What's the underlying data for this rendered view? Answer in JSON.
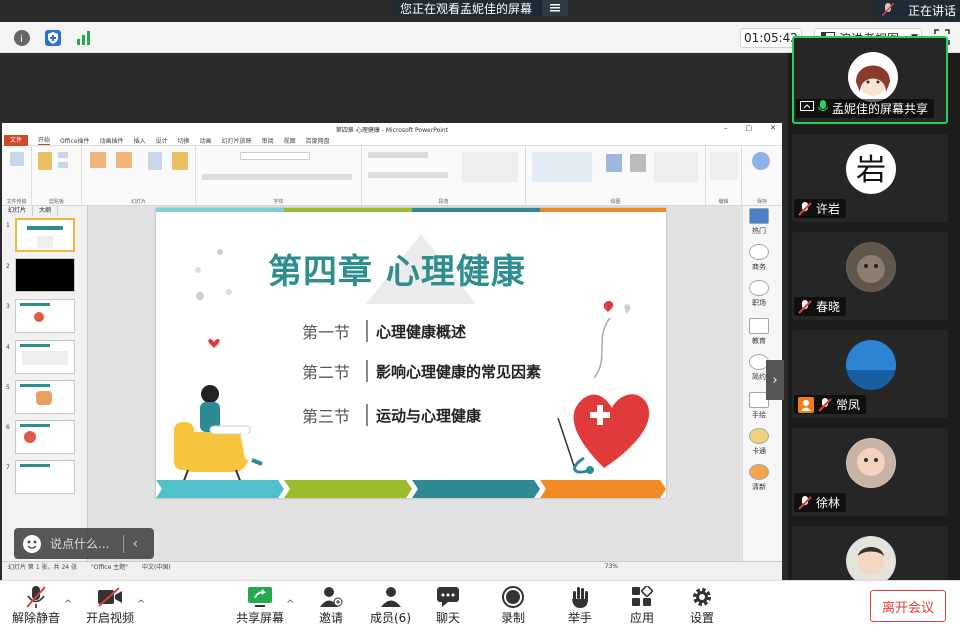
{
  "banner": {
    "viewing_text": "您正在观看孟妮佳的屏幕",
    "speaking_text": "正在讲话"
  },
  "toolbar": {
    "timer": "01:05:42",
    "view_label": "演讲者视图"
  },
  "ppt": {
    "window_title": "第四章 心理健康 - Microsoft PowerPoint",
    "tabs": [
      "文件",
      "开始",
      "Office插件",
      "动画插件",
      "插入",
      "设计",
      "切换",
      "动画",
      "幻灯片放映",
      "审阅",
      "视图",
      "百度网盘"
    ],
    "ribbon_groups": [
      "文件传输",
      "剪贴板",
      "幻灯片",
      "字体",
      "段落",
      "绘图",
      "编辑",
      "保存"
    ],
    "thumb_tabs": [
      "幻灯片",
      "大纲"
    ],
    "thumb_numbers": [
      "1",
      "2",
      "3",
      "4",
      "5",
      "6",
      "7"
    ],
    "status": {
      "slide_info": "幻灯片 第 1 张，共 24 张",
      "theme": "\"Office 主题\"",
      "language": "中文(中国)",
      "zoom": "73%"
    },
    "right_pane": [
      "热门",
      "商务",
      "职场",
      "教育",
      "简约",
      "手绘",
      "卡通",
      "清新"
    ]
  },
  "slide": {
    "title": "第四章  心理健康",
    "sections": [
      {
        "num": "第一节",
        "text": "心理健康概述"
      },
      {
        "num": "第二节",
        "text": "影响心理健康的常见因素"
      },
      {
        "num": "第三节",
        "text": "运动与心理健康"
      }
    ]
  },
  "chat": {
    "placeholder": "说点什么..."
  },
  "participants": [
    {
      "name": "孟妮佳的屏幕共享",
      "active": true
    },
    {
      "name": "许岩"
    },
    {
      "name": "春晓"
    },
    {
      "name": "常凤",
      "host": true
    },
    {
      "name": "徐林"
    },
    {
      "name": ""
    }
  ],
  "bottom": {
    "unmute": "解除静音",
    "start_video": "开启视频",
    "share": "共享屏幕",
    "invite": "邀请",
    "members": "成员(6)",
    "chat": "聊天",
    "record": "录制",
    "raise_hand": "举手",
    "apps": "应用",
    "settings": "设置",
    "leave": "离开会议"
  },
  "colors": {
    "slide_teal": "#2c8e8e",
    "leave_red": "#e0403a",
    "active_green": "#23d160"
  }
}
